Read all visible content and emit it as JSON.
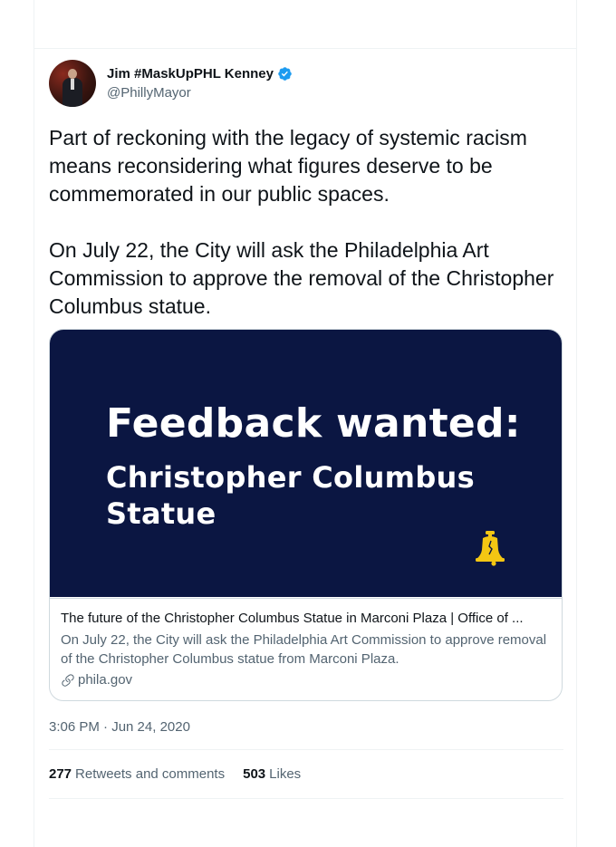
{
  "author": {
    "display_name": "Jim #MaskUpPHL Kenney",
    "handle": "@PhillyMayor",
    "verified": true,
    "avatar_icon": "profile-photo"
  },
  "tweet": {
    "paragraphs": [
      "Part of reckoning with the legacy of systemic racism means reconsidering what figures deserve to be commemorated in our public spaces.",
      "On July 22, the City will ask the Philadelphia Art Commission to approve the removal of the Christopher Columbus statue."
    ],
    "timestamp": "3:06 PM · Jun 24, 2020"
  },
  "link_card": {
    "image_title": "Feedback wanted:",
    "image_subtitle": "Christopher Columbus Statue",
    "image_icon": "liberty-bell-icon",
    "title": "The future of the Christopher Columbus Statue in Marconi Plaza | Office of ...",
    "description": "On July 22, the City will ask the Philadelphia Art Commission to approve removal of the Christopher Columbus statue from Marconi Plaza.",
    "domain": "phila.gov",
    "domain_icon": "link-icon"
  },
  "stats": {
    "retweets_count": "277",
    "retweets_label": "Retweets and comments",
    "likes_count": "503",
    "likes_label": "Likes"
  },
  "colors": {
    "verified_blue": "#1d9bf0",
    "card_background": "#0b1642",
    "bell_yellow": "#f3c613",
    "secondary_text": "#536471"
  }
}
